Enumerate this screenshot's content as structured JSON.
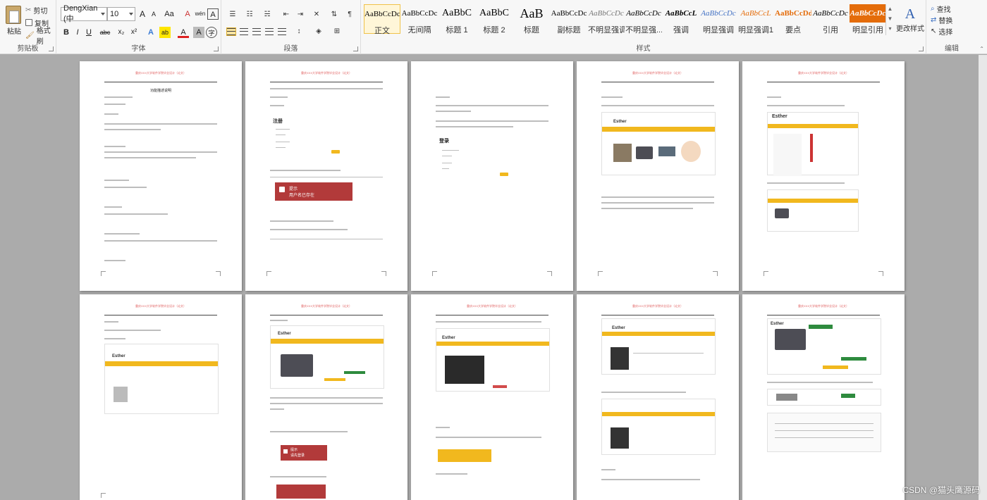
{
  "ribbon": {
    "clipboard": {
      "label": "剪贴板",
      "paste": "粘贴",
      "cut": "剪切",
      "copy": "复制",
      "format_painter": "格式刷"
    },
    "font": {
      "label": "字体",
      "font_name": "DengXian (中",
      "font_size": "10",
      "grow": "A",
      "shrink": "A",
      "case": "Aa",
      "clear": "A",
      "phonetic": "wén",
      "border_char": "A",
      "bold": "B",
      "italic": "I",
      "underline": "U",
      "strike": "abc",
      "subscript": "x₂",
      "superscript": "x²",
      "text_effect": "A",
      "highlight": "ab",
      "font_color": "A",
      "shading": "A",
      "enclose": "字"
    },
    "paragraph": {
      "label": "段落"
    },
    "styles": {
      "label": "样式",
      "items": [
        {
          "sample": "AaBbCcDc",
          "name": "正文",
          "selected": true
        },
        {
          "sample": "AaBbCcDc",
          "name": "无间隔"
        },
        {
          "sample": "AaBbC",
          "name": "标题 1"
        },
        {
          "sample": "AaBbC",
          "name": "标题 2"
        },
        {
          "sample": "AaB",
          "name": "标题"
        },
        {
          "sample": "AaBbCcDc",
          "name": "副标题"
        },
        {
          "sample": "AaBbCcDc",
          "name": "不明显强调"
        },
        {
          "sample": "AaBbCcDc",
          "name": "不明显强..."
        },
        {
          "sample": "AaBbCcL",
          "name": "强调"
        },
        {
          "sample": "AaBbCcDc",
          "name": "明显强调"
        },
        {
          "sample": "AaBbCcL",
          "name": "明显强调1"
        },
        {
          "sample": "AaBbCcDd",
          "name": "要点"
        },
        {
          "sample": "AaBbCcDc",
          "name": "引用"
        },
        {
          "sample": "AaBbCcDc",
          "name": "明显引用"
        }
      ],
      "change_styles": "更改样式"
    },
    "editing": {
      "label": "编辑",
      "find": "查找",
      "replace": "替换",
      "select": "选择"
    }
  },
  "pages": {
    "header_text": "重庆XXX大学软件学院毕业设计（论文）",
    "p1_title": "功能描述说明",
    "p2_login_title": "注册",
    "p2_alert_title": "提示",
    "p2_alert_msg": "用户名已存在",
    "p3_login_title": "登录",
    "p4_brand": "Esther",
    "p5_brand": "Esther",
    "p6_brand": "Esther",
    "p7_brand": "Esther",
    "p7_alert_title": "提示",
    "p7_alert_msg": "请先登录",
    "p8_brand": "Esther",
    "p9_brand": "Esther",
    "p10_brand": "Esther"
  },
  "watermark": "CSDN @猫头鹰源码",
  "colors": {
    "accent_yellow": "#f1b81e",
    "alert_red": "#b23a3a",
    "header_red": "#e06060"
  }
}
